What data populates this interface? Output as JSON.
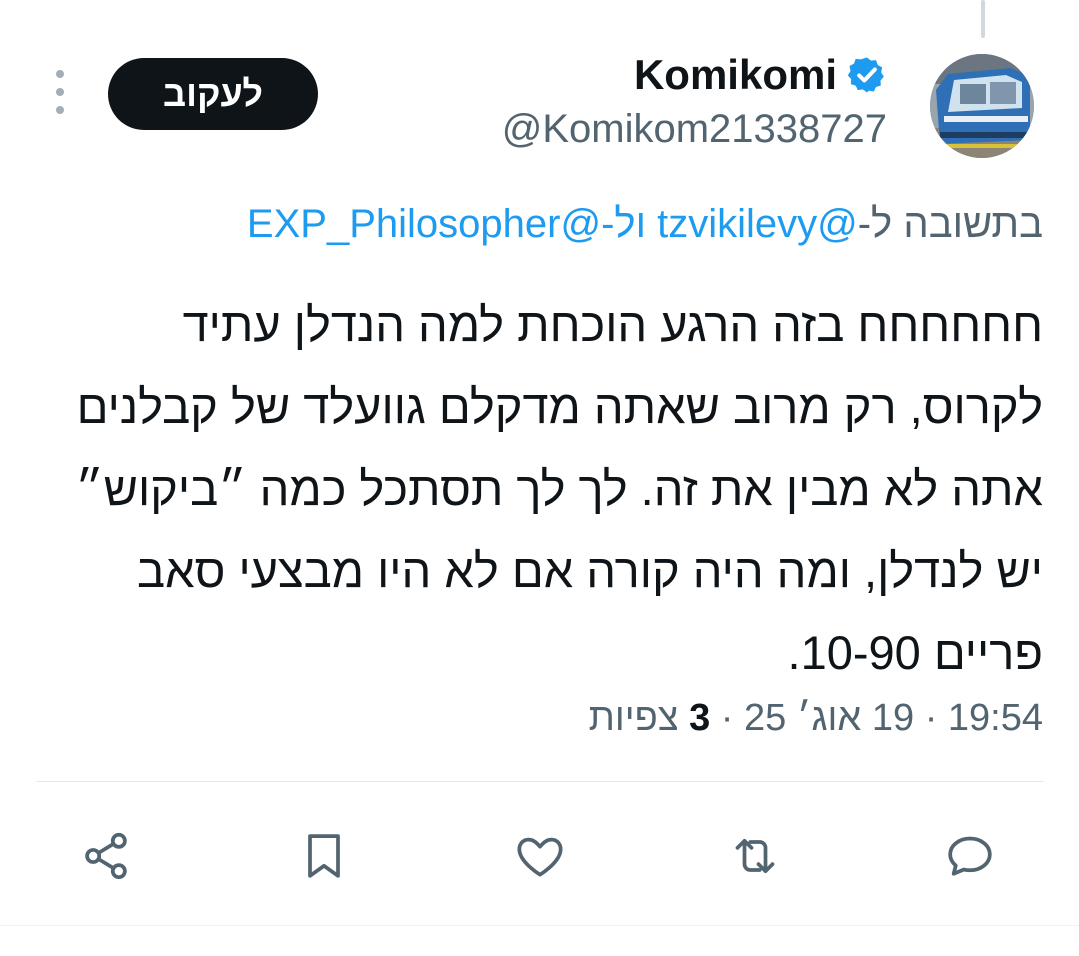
{
  "author": {
    "display_name": "Komikomi",
    "handle": "@Komikom21338727",
    "verified": true
  },
  "header": {
    "follow_label": "לעקוב"
  },
  "reply_context": {
    "prefix": "בתשובה ל-",
    "mention_1": "@tzvikilevy",
    "joiner": " ול-",
    "mention_2": "@EXP_Philosopher"
  },
  "tweet": {
    "text": "חחחחחח בזה הרגע הוכחת למה הנדלן עתיד לקרוס, רק מרוב שאתה מדקלם גוועלד של קבלנים אתה לא מבין את זה. לך לך תסתכל כמה ״ביקוש״ יש לנדלן, ומה היה קורה אם לא היו מבצעי סאב פריים 10-90."
  },
  "meta": {
    "time": "19:54",
    "date": "19 אוג׳ 25",
    "separator": "·",
    "views_count": "3",
    "views_label": "צפיות"
  },
  "actions": [
    {
      "name": "reply",
      "icon": "comment-icon"
    },
    {
      "name": "retweet",
      "icon": "retweet-icon"
    },
    {
      "name": "like",
      "icon": "heart-icon"
    },
    {
      "name": "bookmark",
      "icon": "bookmark-icon"
    },
    {
      "name": "share",
      "icon": "share-icon"
    }
  ],
  "colors": {
    "text": "#0f1419",
    "secondary": "#536471",
    "link": "#1d9bf0",
    "verified": "#1d9bf0",
    "icon": "#536471",
    "follow_bg": "#0f1419"
  }
}
